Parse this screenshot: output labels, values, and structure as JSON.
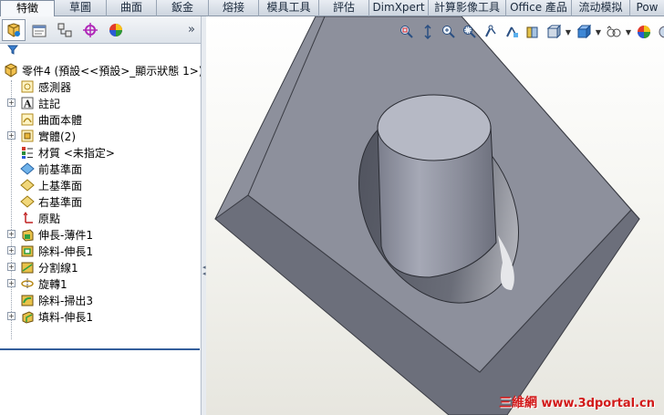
{
  "commandmanager": {
    "tabs": [
      {
        "label": "特徵",
        "active": true
      },
      {
        "label": "草圖",
        "active": false
      },
      {
        "label": "曲面",
        "active": false
      },
      {
        "label": "鈑金",
        "active": false
      },
      {
        "label": "熔接",
        "active": false
      },
      {
        "label": "模具工具",
        "active": false
      },
      {
        "label": "評估",
        "active": false
      },
      {
        "label": "DimXpert",
        "active": false
      },
      {
        "label": "計算影像工具",
        "active": false
      },
      {
        "label": "Office 產品",
        "active": false
      },
      {
        "label": "流动模拟",
        "active": false
      },
      {
        "label": "Pow",
        "active": false
      }
    ]
  },
  "feature_panel": {
    "tab_icons": [
      "feature-manager-icon",
      "property-manager-icon",
      "configuration-manager-icon",
      "dimxpert-manager-icon",
      "display-manager-icon"
    ],
    "root_label": "零件4  (預設<<預設>_顯示狀態 1>)",
    "items": [
      {
        "label": "感測器",
        "icon": "sensor-icon",
        "expandable": false
      },
      {
        "label": "註記",
        "icon": "annotation-icon",
        "expandable": true
      },
      {
        "label": "曲面本體",
        "icon": "surface-bodies-icon",
        "expandable": false
      },
      {
        "label": "實體(2)",
        "icon": "solid-bodies-icon",
        "expandable": true
      },
      {
        "label": "材質 <未指定>",
        "icon": "material-icon",
        "expandable": false
      },
      {
        "label": "前基準面",
        "icon": "plane-icon",
        "expandable": false
      },
      {
        "label": "上基準面",
        "icon": "plane-icon",
        "expandable": false
      },
      {
        "label": "右基準面",
        "icon": "plane-icon",
        "expandable": false
      },
      {
        "label": "原點",
        "icon": "origin-icon",
        "expandable": false
      },
      {
        "label": "伸長-薄件1",
        "icon": "extrude-thin-icon",
        "expandable": true
      },
      {
        "label": "除料-伸長1",
        "icon": "cut-extrude-icon",
        "expandable": true
      },
      {
        "label": "分割線1",
        "icon": "split-line-icon",
        "expandable": true
      },
      {
        "label": "旋轉1",
        "icon": "revolve-icon",
        "expandable": true
      },
      {
        "label": "除料-掃出3",
        "icon": "cut-sweep-icon",
        "expandable": false
      },
      {
        "label": "填料-伸長1",
        "icon": "boss-extrude-icon",
        "expandable": true
      }
    ]
  },
  "heads_up_toolbar": {
    "icons": [
      "zoom-to-fit-icon",
      "zoom-to-area-icon",
      "previous-view-icon",
      "section-view-icon",
      "view-orientation-icon",
      "display-style-icon",
      "hide-show-items-icon",
      "edit-appearance-icon",
      "apply-scene-icon"
    ]
  },
  "watermark": {
    "cn": "三維網",
    "url": "www.3dportal.cn"
  },
  "colors": {
    "tab_bg": "#dde3ea",
    "panel_divider": "#345e9b",
    "part_face": "#8d909c",
    "watermark": "#d21a1a"
  }
}
